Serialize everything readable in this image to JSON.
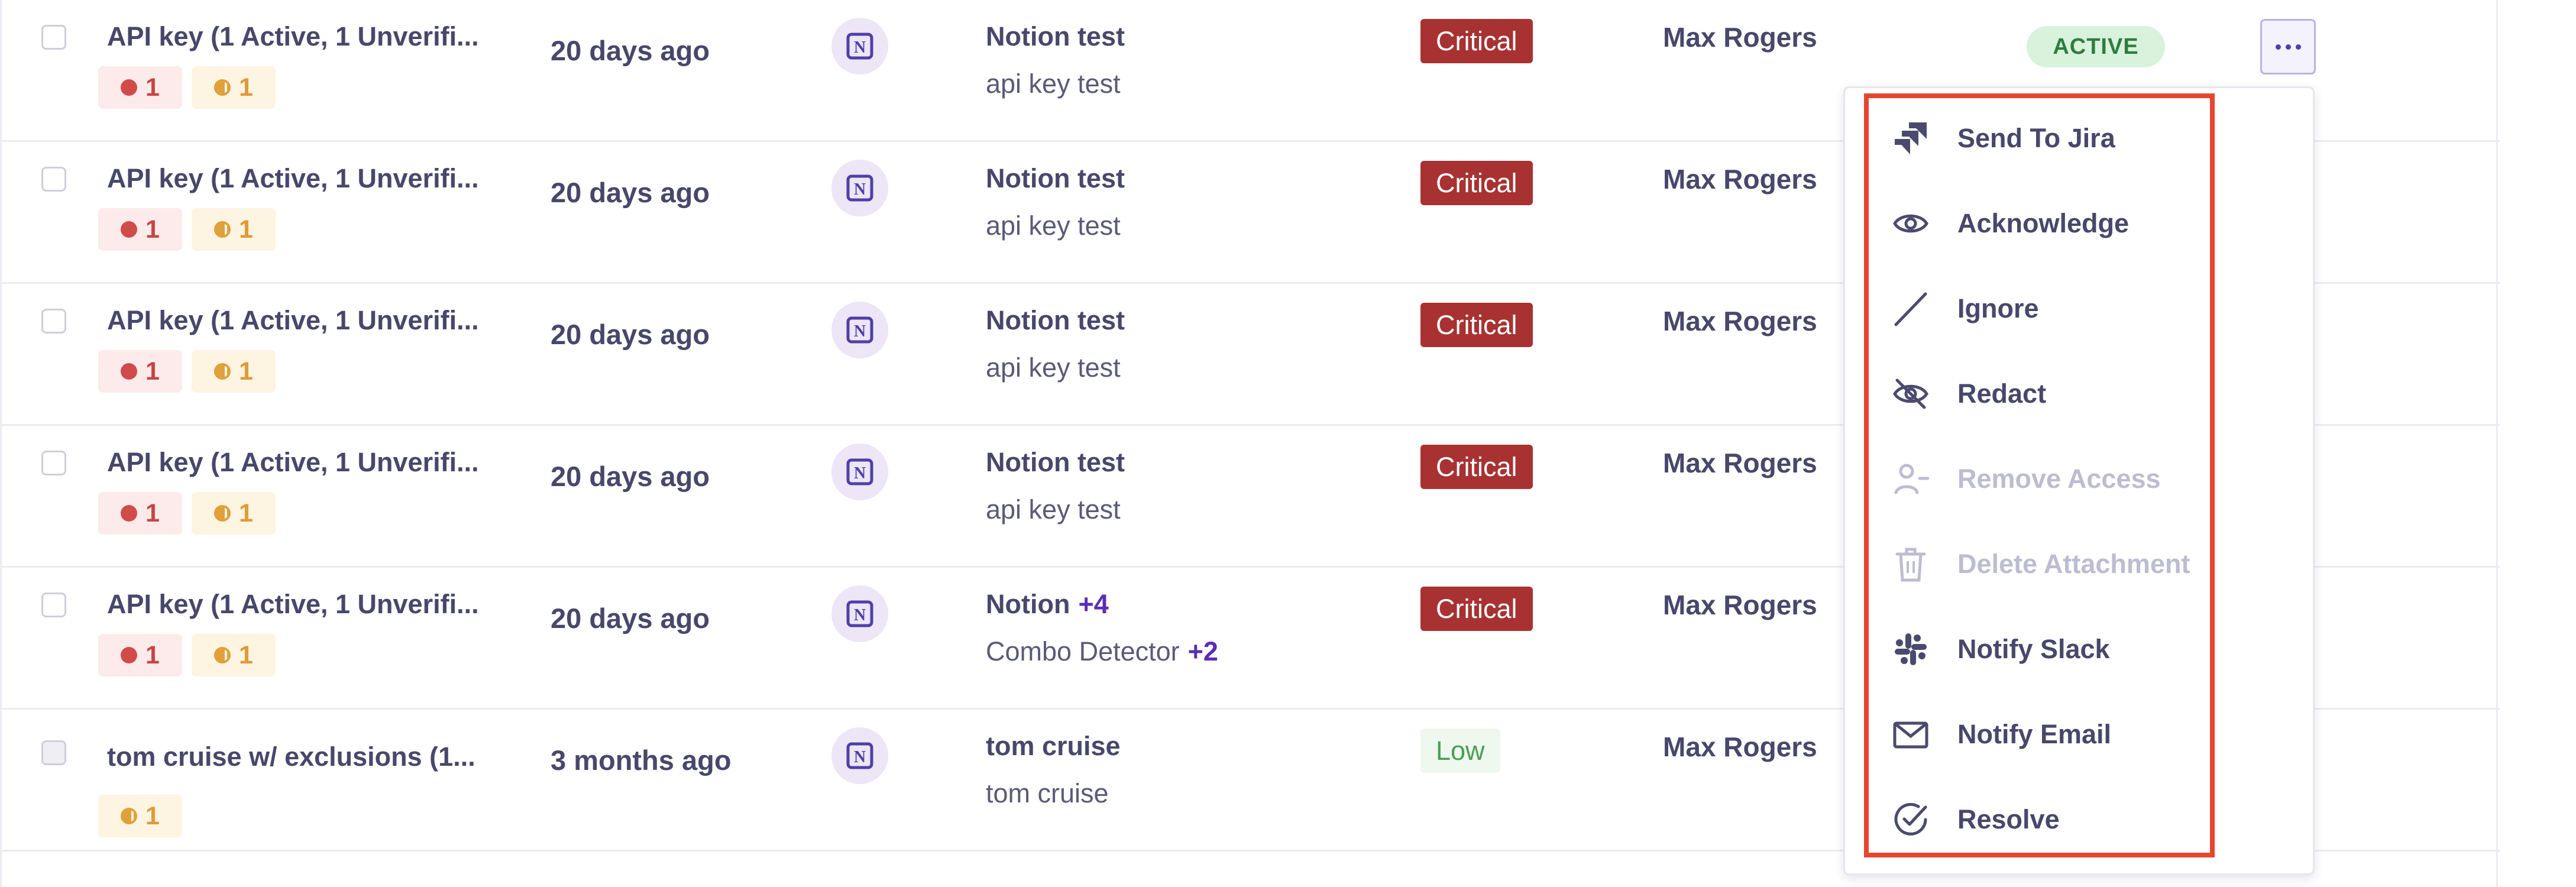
{
  "rows": [
    {
      "title": "API key (1 Active, 1 Unverifi...",
      "badges": {
        "red": "1",
        "orange": "1"
      },
      "time": "20 days ago",
      "detector": "Notion test",
      "detector_plus": "",
      "sub": "api key test",
      "sub_plus": "",
      "severity": "Critical",
      "owner": "Max Rogers",
      "status": "ACTIVE"
    },
    {
      "title": "API key (1 Active, 1 Unverifi...",
      "badges": {
        "red": "1",
        "orange": "1"
      },
      "time": "20 days ago",
      "detector": "Notion test",
      "detector_plus": "",
      "sub": "api key test",
      "sub_plus": "",
      "severity": "Critical",
      "owner": "Max Rogers"
    },
    {
      "title": "API key (1 Active, 1 Unverifi...",
      "badges": {
        "red": "1",
        "orange": "1"
      },
      "time": "20 days ago",
      "detector": "Notion test",
      "detector_plus": "",
      "sub": "api key test",
      "sub_plus": "",
      "severity": "Critical",
      "owner": "Max Rogers"
    },
    {
      "title": "API key (1 Active, 1 Unverifi...",
      "badges": {
        "red": "1",
        "orange": "1"
      },
      "time": "20 days ago",
      "detector": "Notion test",
      "detector_plus": "",
      "sub": "api key test",
      "sub_plus": "",
      "severity": "Critical",
      "owner": "Max Rogers"
    },
    {
      "title": "API key (1 Active, 1 Unverifi...",
      "badges": {
        "red": "1",
        "orange": "1"
      },
      "time": "20 days ago",
      "detector": "Notion",
      "detector_plus": "+4",
      "sub": "Combo Detector",
      "sub_plus": "+2",
      "severity": "Critical",
      "owner": "Max Rogers"
    },
    {
      "title": "tom cruise w/ exclusions (1...",
      "badges": {
        "orange": "1"
      },
      "time": "3 months ago",
      "detector": "tom cruise",
      "detector_plus": "",
      "sub": "tom cruise",
      "sub_plus": "",
      "severity": "Low",
      "owner": "Max Rogers"
    }
  ],
  "menu": {
    "items": [
      {
        "label": "Send To Jira",
        "icon": "jira-icon",
        "enabled": true
      },
      {
        "label": "Acknowledge",
        "icon": "eye-icon",
        "enabled": true
      },
      {
        "label": "Ignore",
        "icon": "slash-icon",
        "enabled": true
      },
      {
        "label": "Redact",
        "icon": "eye-off-icon",
        "enabled": true
      },
      {
        "label": "Remove Access",
        "icon": "user-minus-icon",
        "enabled": false
      },
      {
        "label": "Delete Attachment",
        "icon": "trash-icon",
        "enabled": false
      },
      {
        "label": "Notify Slack",
        "icon": "slack-icon",
        "enabled": true
      },
      {
        "label": "Notify Email",
        "icon": "mail-icon",
        "enabled": true
      },
      {
        "label": "Resolve",
        "icon": "check-circle-icon",
        "enabled": true
      }
    ]
  },
  "colors": {
    "critical": "#a83232",
    "highlight": "#e8442e",
    "accent": "#5a2db4",
    "active_bg": "#d8f2dc"
  }
}
